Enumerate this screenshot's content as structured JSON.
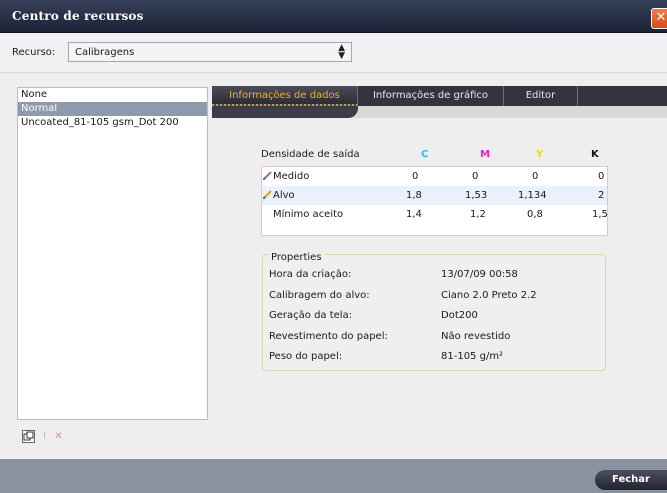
{
  "window": {
    "title": "Centro de recursos",
    "close_glyph": "✕"
  },
  "resource": {
    "label": "Recurso:",
    "selected": "Calibragens"
  },
  "list": {
    "items": [
      "None",
      "Normal",
      "Uncoated_81-105 gsm_Dot 200"
    ],
    "selected_index": 1
  },
  "tabs": [
    "Informações de dados",
    "Informações de gráfico",
    "Editor"
  ],
  "active_tab": 0,
  "density": {
    "header": "Densidade de saída",
    "channels": [
      "C",
      "M",
      "Y",
      "K"
    ],
    "channel_colors": [
      "#18c8e8",
      "#e020c8",
      "#e8e000",
      "#111111"
    ],
    "rows": [
      {
        "label": "Medido",
        "values": [
          "0",
          "0",
          "0",
          "0"
        ]
      },
      {
        "label": "Alvo",
        "values": [
          "1,8",
          "1,53",
          "1,134",
          "2"
        ]
      },
      {
        "label": "Mínimo aceito",
        "values": [
          "1,4",
          "1,2",
          "0,8",
          "1,5"
        ]
      }
    ]
  },
  "properties": {
    "legend": "Properties",
    "rows": [
      {
        "key": "Hora da criação:",
        "value": "13/07/09 00:58"
      },
      {
        "key": "Calibragem do alvo:",
        "value": "Ciano 2.0  Preto 2.2"
      },
      {
        "key": "Geração da tela:",
        "value": "Dot200"
      },
      {
        "key": "Revestimento do papel:",
        "value": "Não revestido"
      },
      {
        "key": "Peso do papel:",
        "value": "81-105 g/m²"
      }
    ]
  },
  "footer": {
    "close_label": "Fechar"
  }
}
